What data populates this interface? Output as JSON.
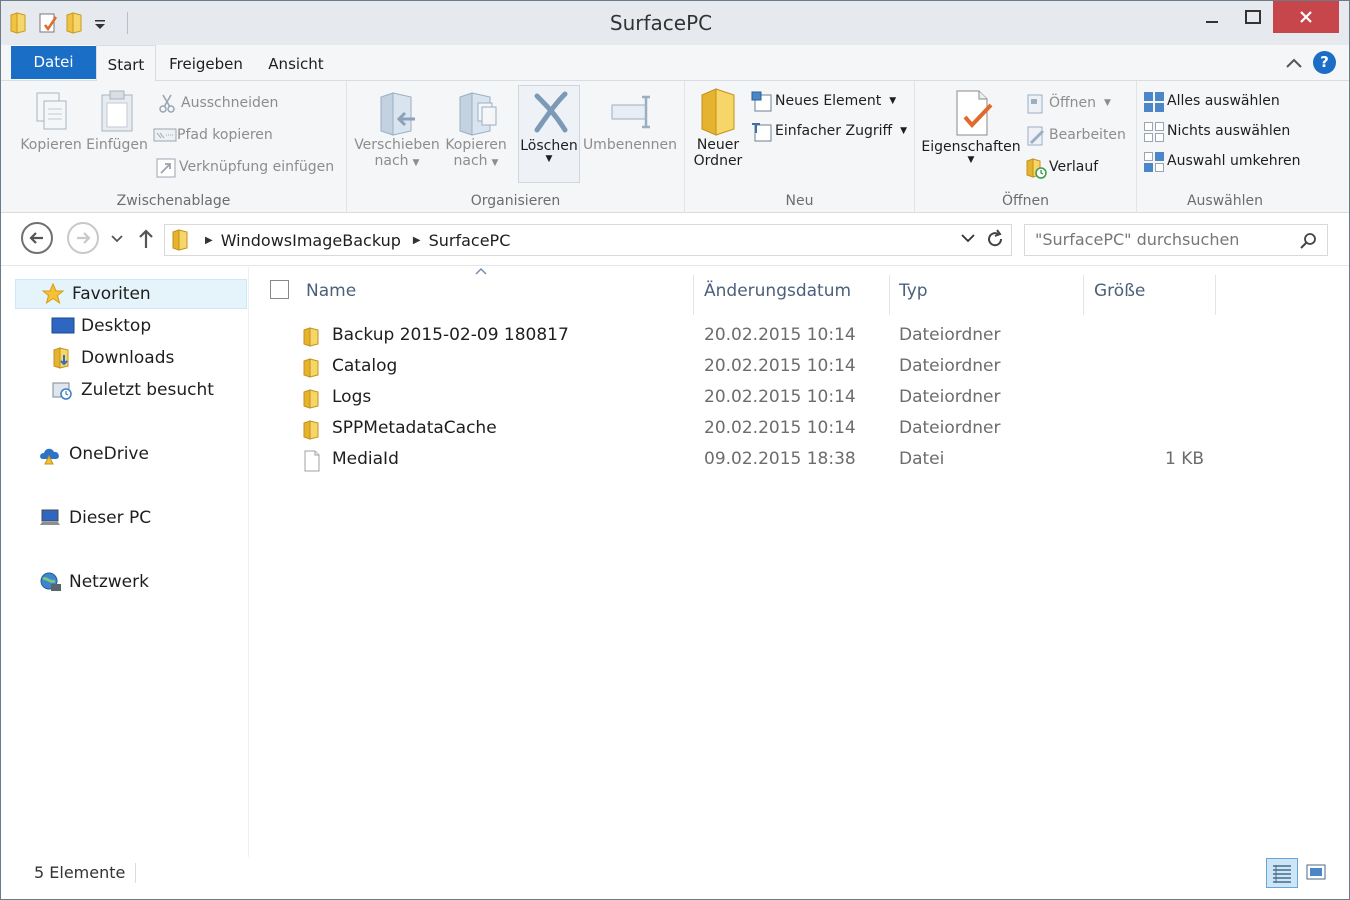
{
  "window": {
    "title": "SurfacePC",
    "min_label": "—",
    "max_label": "☐",
    "close_label": "✕"
  },
  "tabs": {
    "file": "Datei",
    "start": "Start",
    "share": "Freigeben",
    "view": "Ansicht",
    "collapse": "︿",
    "help": "?"
  },
  "ribbon": {
    "clipboard": {
      "label": "Zwischenablage",
      "copy": "Kopieren",
      "paste": "Einfügen",
      "cut": "Ausschneiden",
      "copy_path": "Pfad kopieren",
      "paste_shortcut": "Verknüpfung einfügen"
    },
    "organize": {
      "label": "Organisieren",
      "move_to_l1": "Verschieben",
      "move_to_l2": "nach",
      "copy_to_l1": "Kopieren",
      "copy_to_l2": "nach",
      "delete": "Löschen",
      "rename": "Umbenennen"
    },
    "new": {
      "label": "Neu",
      "new_folder_l1": "Neuer",
      "new_folder_l2": "Ordner",
      "new_item": "Neues Element",
      "easy_access": "Einfacher Zugriff"
    },
    "open": {
      "label": "Öffnen",
      "properties": "Eigenschaften",
      "open": "Öffnen",
      "edit": "Bearbeiten",
      "history": "Verlauf"
    },
    "select": {
      "label": "Auswählen",
      "select_all": "Alles auswählen",
      "select_none": "Nichts auswählen",
      "invert": "Auswahl umkehren"
    }
  },
  "address": {
    "segments": [
      "WindowsImageBackup",
      "SurfacePC"
    ],
    "search_placeholder": "\"SurfacePC\" durchsuchen"
  },
  "navpane": {
    "favorites": "Favoriten",
    "desktop": "Desktop",
    "downloads": "Downloads",
    "recent": "Zuletzt besucht",
    "onedrive": "OneDrive",
    "this_pc": "Dieser PC",
    "network": "Netzwerk"
  },
  "columns": {
    "name": "Name",
    "date": "Änderungsdatum",
    "type": "Typ",
    "size": "Größe"
  },
  "files": [
    {
      "name": "Backup 2015-02-09 180817",
      "date": "20.02.2015 10:14",
      "type": "Dateiordner",
      "size": "",
      "icon": "folder-icon"
    },
    {
      "name": "Catalog",
      "date": "20.02.2015 10:14",
      "type": "Dateiordner",
      "size": "",
      "icon": "folder-icon"
    },
    {
      "name": "Logs",
      "date": "20.02.2015 10:14",
      "type": "Dateiordner",
      "size": "",
      "icon": "folder-icon"
    },
    {
      "name": "SPPMetadataCache",
      "date": "20.02.2015 10:14",
      "type": "Dateiordner",
      "size": "",
      "icon": "folder-icon"
    },
    {
      "name": "MediaId",
      "date": "09.02.2015 18:38",
      "type": "Datei",
      "size": "1 KB",
      "icon": "file-icon"
    }
  ],
  "status": {
    "count": "5 Elemente"
  },
  "colors": {
    "accent": "#1a6ec5",
    "close": "#c7464c",
    "folder": "#f1c84a"
  }
}
